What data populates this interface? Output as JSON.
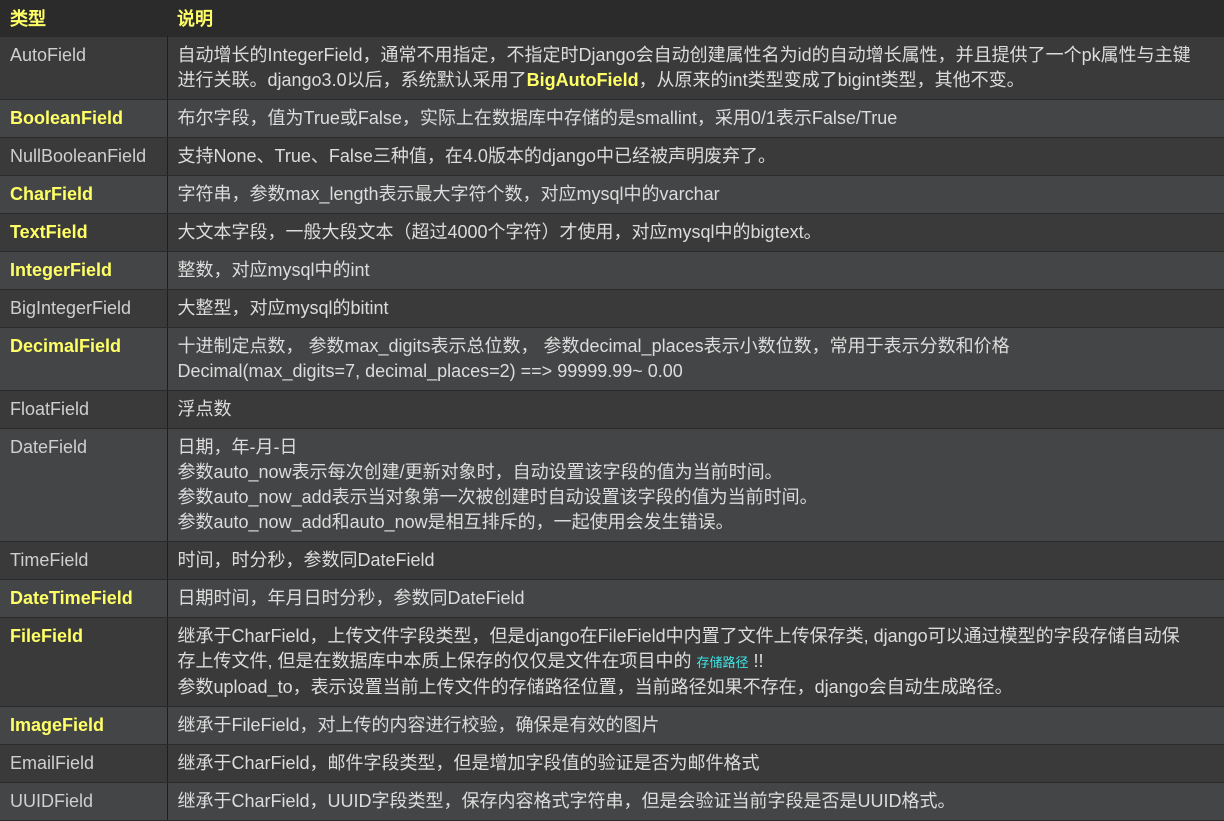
{
  "header": {
    "col_type": "类型",
    "col_desc": "说明"
  },
  "rows": {
    "autofield": {
      "name": "AutoField",
      "l1": "自动增长的IntegerField，通常不用指定，不指定时Django会自动创建属性名为id的自动增长属性，并且提供了一个pk属性与主键",
      "l2a": "进行关联。django3.0以后，系统默认采用了",
      "l2b": "BigAutoField",
      "l2c": "，从原来的int类型变成了bigint类型，其他不变。"
    },
    "booleanfield": {
      "name": "BooleanField",
      "l1": "布尔字段，值为True或False，实际上在数据库中存储的是smallint，采用0/1表示False/True"
    },
    "nullbooleanfield": {
      "name": "NullBooleanField",
      "l1": "支持None、True、False三种值，在4.0版本的django中已经被声明废弃了。"
    },
    "charfield": {
      "name": "CharField",
      "l1": "字符串，参数max_length表示最大字符个数，对应mysql中的varchar"
    },
    "textfield": {
      "name": "TextField",
      "l1": "大文本字段，一般大段文本（超过4000个字符）才使用，对应mysql中的bigtext。"
    },
    "integerfield": {
      "name": "IntegerField",
      "l1": "整数，对应mysql中的int"
    },
    "bigintegerfield": {
      "name": "BigIntegerField",
      "l1": "大整型，对应mysql的bitint"
    },
    "decimalfield": {
      "name": "DecimalField",
      "l1": "十进制定点数， 参数max_digits表示总位数， 参数decimal_places表示小数位数，常用于表示分数和价格",
      "l2": "Decimal(max_digits=7, decimal_places=2) ==> 99999.99~ 0.00"
    },
    "floatfield": {
      "name": "FloatField",
      "l1": "浮点数"
    },
    "datefield": {
      "name": "DateField",
      "l1": "日期，年-月-日",
      "l2": "参数auto_now表示每次创建/更新对象时，自动设置该字段的值为当前时间。",
      "l3": "参数auto_now_add表示当对象第一次被创建时自动设置该字段的值为当前时间。",
      "l4": "参数auto_now_add和auto_now是相互排斥的，一起使用会发生错误。"
    },
    "timefield": {
      "name": "TimeField",
      "l1": "时间，时分秒，参数同DateField"
    },
    "datetimefield": {
      "name": "DateTimeField",
      "l1": "日期时间，年月日时分秒，参数同DateField"
    },
    "filefield": {
      "name": "FileField",
      "l1": "继承于CharField，上传文件字段类型，但是django在FileField中内置了文件上传保存类, django可以通过模型的字段存储自动保",
      "l2a": "存上传文件, 但是在数据库中本质上保存的仅仅是文件在项目中的 ",
      "l2b": "存储路径",
      "l2c": " !!",
      "l3": "参数upload_to，表示设置当前上传文件的存储路径位置，当前路径如果不存在，django会自动生成路径。"
    },
    "imagefield": {
      "name": "ImageField",
      "l1": "继承于FileField，对上传的内容进行校验，确保是有效的图片"
    },
    "emailfield": {
      "name": "EmailField",
      "l1": "继承于CharField，邮件字段类型，但是增加字段值的验证是否为邮件格式"
    },
    "uuidfield": {
      "name": "UUIDField",
      "l1": "继承于CharField，UUID字段类型，保存内容格式字符串，但是会验证当前字段是否是UUID格式。"
    }
  },
  "colors": {
    "highlight": "#ffff66",
    "text": "#dcdcdc",
    "row_a": "#3a3a3a",
    "row_b": "#444546",
    "link": "#3ee6e6"
  }
}
